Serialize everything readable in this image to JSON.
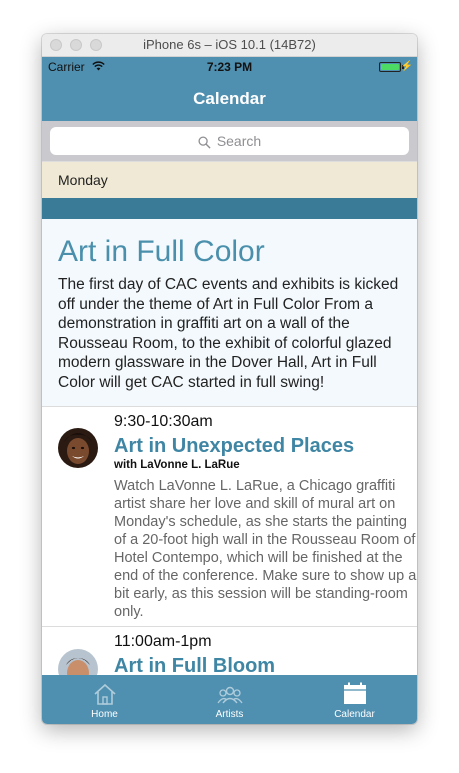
{
  "window": {
    "title": "iPhone 6s – iOS 10.1 (14B72)"
  },
  "status": {
    "carrier": "Carrier",
    "time": "7:23 PM"
  },
  "nav": {
    "title": "Calendar"
  },
  "search": {
    "placeholder": "Search"
  },
  "section": {
    "day": "Monday"
  },
  "feature": {
    "title": "Art in Full Color",
    "body": "The first day of CAC events and exhibits is kicked off under the theme of Art in Full Color From a demonstration in graffiti art on a wall of the Rousseau Room, to the exhibit of colorful glazed modern glassware in the Dover Hall, Art in Full Color will get CAC started in full swing!"
  },
  "sessions": [
    {
      "time": "9:30-10:30am",
      "title": "Art in Unexpected Places",
      "with": "with LaVonne L. LaRue",
      "description": "Watch LaVonne L. LaRue, a Chicago graffiti artist share her love and skill of mural art on Monday's schedule, as she starts the painting of a 20-foot high wall in the Rousseau Room of Hotel Contempo, which will be finished at the end of the conference. Make sure to show up a bit early, as this session will be standing-room only."
    },
    {
      "time": "11:00am-1pm",
      "title": "Art in Full Bloom"
    }
  ],
  "tabs": [
    {
      "label": "Home",
      "icon": "home-icon",
      "active": false
    },
    {
      "label": "Artists",
      "icon": "people-icon",
      "active": false
    },
    {
      "label": "Calendar",
      "icon": "calendar-icon",
      "active": true
    }
  ],
  "colors": {
    "bar": "#4f8fb0",
    "accent": "#3f86a4",
    "section_bg": "#efe9d5",
    "strip": "#3a7c98"
  }
}
